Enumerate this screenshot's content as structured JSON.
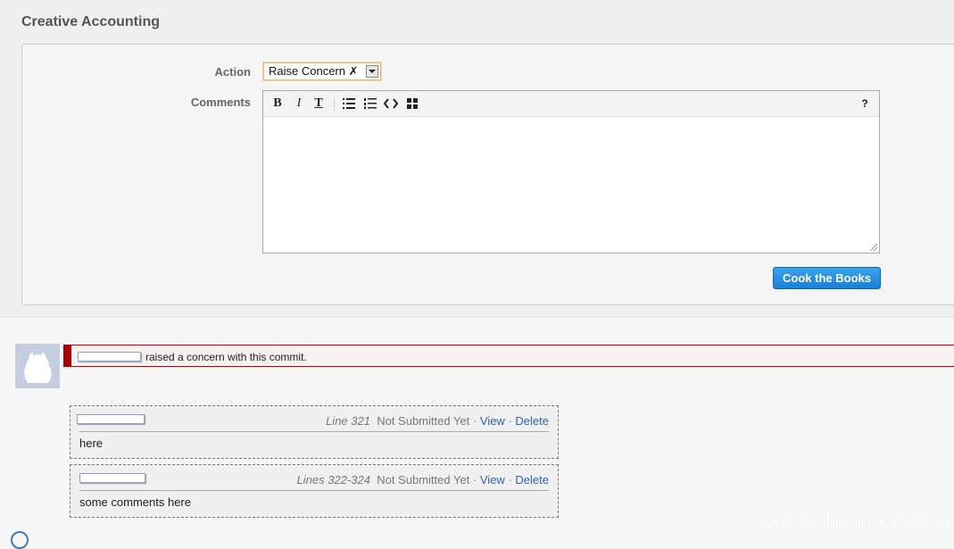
{
  "page": {
    "title": "Creative Accounting"
  },
  "form": {
    "action_label": "Action",
    "action_value": "Raise Concern ✗",
    "comments_label": "Comments",
    "comments_value": "",
    "toolbar": {
      "bold": "B",
      "italic": "I",
      "text": "T",
      "help": "?",
      "icons": [
        "bold-icon",
        "italic-icon",
        "text-style-icon",
        "bullet-list-icon",
        "numbered-list-icon",
        "code-icon",
        "table-icon",
        "help-icon"
      ]
    },
    "submit_label": "Cook the Books"
  },
  "event": {
    "text": "raised a concern with this commit.",
    "border_color": "#aa0000"
  },
  "inline_comments": [
    {
      "line": "Line 321",
      "status": "Not Submitted Yet",
      "view": "View",
      "delete": "Delete",
      "body": "here"
    },
    {
      "line": "Lines 322-324",
      "status": "Not Submitted Yet",
      "view": "View",
      "delete": "Delete",
      "body": "some comments here"
    }
  ],
  "watermark": "www.linuxeye.com",
  "colors": {
    "accent": "#1a7fd3",
    "link": "#3062a8",
    "concern": "#aa0000"
  }
}
